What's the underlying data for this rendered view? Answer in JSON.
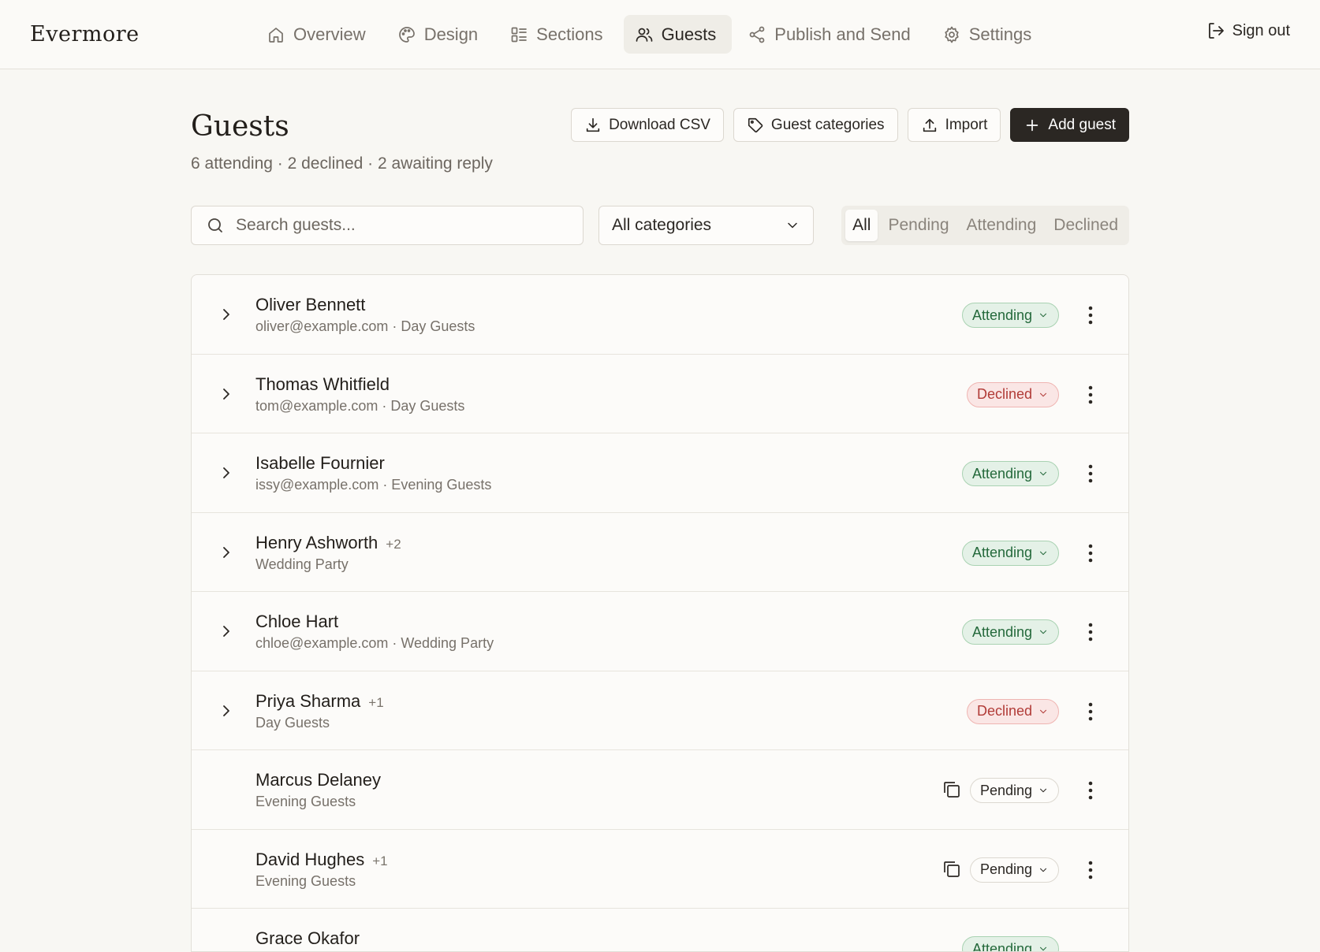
{
  "app": {
    "logo": "Evermore",
    "sign_out": "Sign out"
  },
  "nav": {
    "items": [
      {
        "label": "Overview",
        "icon": "home-icon"
      },
      {
        "label": "Design",
        "icon": "palette-icon"
      },
      {
        "label": "Sections",
        "icon": "sections-icon"
      },
      {
        "label": "Guests",
        "icon": "users-icon",
        "active": true
      },
      {
        "label": "Publish and Send",
        "icon": "share-icon"
      },
      {
        "label": "Settings",
        "icon": "gear-icon"
      }
    ]
  },
  "page": {
    "title": "Guests",
    "summary": "6 attending · 2 declined · 2 awaiting reply",
    "actions": {
      "download_csv": "Download CSV",
      "guest_categories": "Guest categories",
      "import": "Import",
      "add_guest": "Add guest"
    }
  },
  "filters": {
    "search_placeholder": "Search guests...",
    "category_selected": "All categories",
    "status_tabs": [
      "All",
      "Pending",
      "Attending",
      "Declined"
    ],
    "active_status": "All"
  },
  "colors": {
    "attending": "#24693b",
    "declined": "#b13b37",
    "primary": "#2b2723"
  },
  "guests": [
    {
      "name": "Oliver Bennett",
      "plus": "",
      "sub": "oliver@example.com · Day Guests",
      "status": "Attending",
      "expandable": true,
      "copy": false
    },
    {
      "name": "Thomas Whitfield",
      "plus": "",
      "sub": "tom@example.com · Day Guests",
      "status": "Declined",
      "expandable": true,
      "copy": false
    },
    {
      "name": "Isabelle Fournier",
      "plus": "",
      "sub": "issy@example.com · Evening Guests",
      "status": "Attending",
      "expandable": true,
      "copy": false
    },
    {
      "name": "Henry Ashworth",
      "plus": "+2",
      "sub": "Wedding Party",
      "status": "Attending",
      "expandable": true,
      "copy": false
    },
    {
      "name": "Chloe Hart",
      "plus": "",
      "sub": "chloe@example.com · Wedding Party",
      "status": "Attending",
      "expandable": true,
      "copy": false
    },
    {
      "name": "Priya Sharma",
      "plus": "+1",
      "sub": "Day Guests",
      "status": "Declined",
      "expandable": true,
      "copy": false
    },
    {
      "name": "Marcus Delaney",
      "plus": "",
      "sub": "Evening Guests",
      "status": "Pending",
      "expandable": false,
      "copy": true
    },
    {
      "name": "David Hughes",
      "plus": "+1",
      "sub": "Evening Guests",
      "status": "Pending",
      "expandable": false,
      "copy": true
    },
    {
      "name": "Grace Okafor",
      "plus": "",
      "sub": "",
      "status": "Attending",
      "expandable": false,
      "copy": false
    }
  ]
}
